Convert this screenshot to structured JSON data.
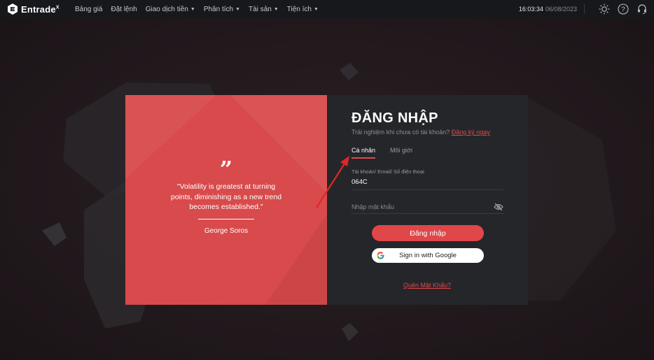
{
  "app": {
    "brand": "Entrade",
    "brand_sup": "X"
  },
  "nav": {
    "items": [
      {
        "label": "Bảng giá",
        "dropdown": false
      },
      {
        "label": "Đặt lệnh",
        "dropdown": false
      },
      {
        "label": "Giao dịch tiền",
        "dropdown": true
      },
      {
        "label": "Phân tích",
        "dropdown": true
      },
      {
        "label": "Tài sản",
        "dropdown": true
      },
      {
        "label": "Tiện ích",
        "dropdown": true
      }
    ]
  },
  "header_right": {
    "time": "16:03:34",
    "date": "06/08/2023",
    "icons": [
      "sun-icon",
      "help-icon",
      "headset-icon"
    ]
  },
  "quote": {
    "mark": "”",
    "text": "\"Volatility is greatest at turning points, diminishing as a new trend becomes established.\"",
    "author": "George Soros"
  },
  "login": {
    "title": "ĐĂNG NHẬP",
    "subtitle": "Trải nghiệm khi chưa có tài khoản?",
    "register_link": "Đăng ký ngay",
    "tabs": [
      {
        "label": "Cá nhân",
        "active": true
      },
      {
        "label": "Môi giới",
        "active": false
      }
    ],
    "account_label": "Tài khoản/ Email/ Số điện thoại",
    "account_value": "064C",
    "password_placeholder": "Nhập mật khẩu",
    "login_button": "Đăng nhập",
    "google_button": "Sign in with Google",
    "forgot_link": "Quên Mật Khẩu?"
  },
  "colors": {
    "accent": "#df4748",
    "panel_dark": "#25262a",
    "quote_panel": "#d84a4b",
    "topbar": "#17181c"
  }
}
